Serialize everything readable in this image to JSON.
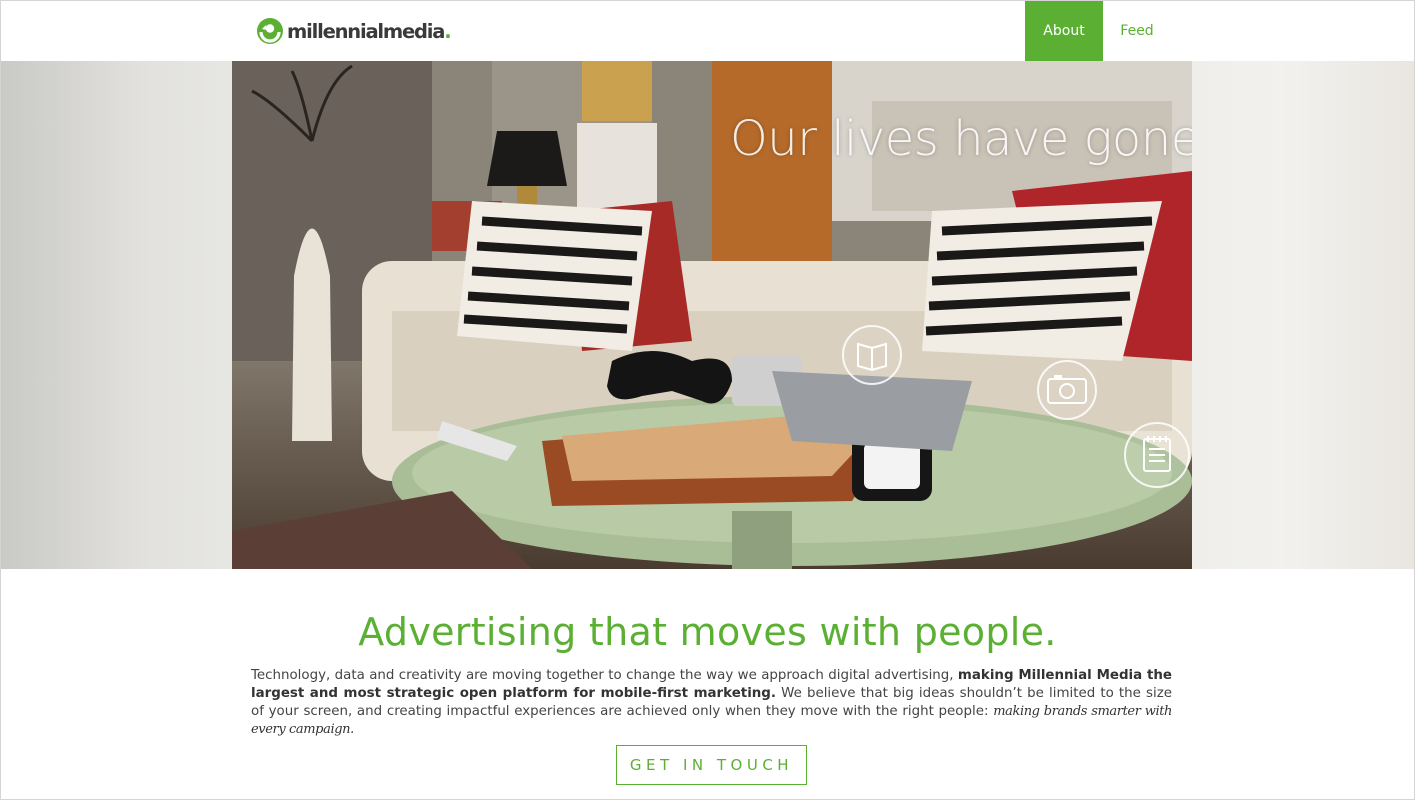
{
  "header": {
    "logo_text": "millennialmedia",
    "logo_dot": ".",
    "nav": [
      {
        "label": "About",
        "active": true
      },
      {
        "label": "Feed",
        "active": false
      }
    ]
  },
  "hero": {
    "caption": "Our lives have gone mobile",
    "overlay_icons": [
      "book-icon",
      "camera-icon",
      "notepad-icon"
    ]
  },
  "content": {
    "headline": "Advertising that moves with people.",
    "paragraph": {
      "part1": "Technology, data and creativity are moving together to change the way we approach digital advertising, ",
      "bold": "making Millennial Media the largest and most strategic open platform for mobile-first marketing.",
      "part2": " We believe that big ideas shouldn’t be limited to the size of your screen, and creating impactful experiences are achieved only when they move with the right people: ",
      "italic": "making brands smarter with every campaign."
    },
    "cta_label": "GET IN TOUCH"
  },
  "colors": {
    "brand_green": "#5bb034",
    "text": "#444444",
    "logo_text": "#3a3a3a"
  }
}
